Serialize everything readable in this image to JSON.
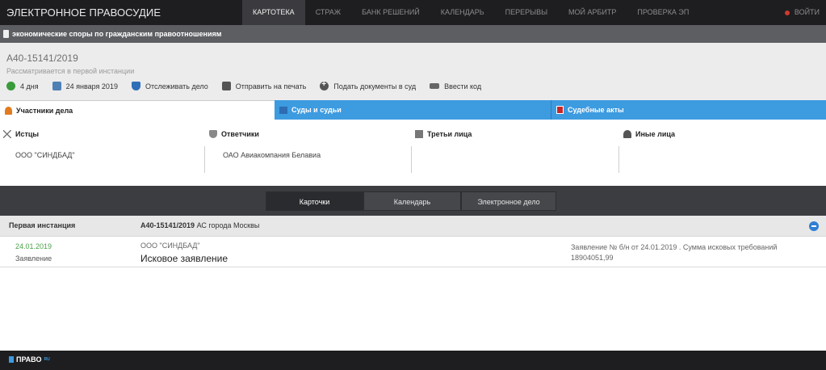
{
  "header": {
    "brand": "ЭЛЕКТРОННОЕ ПРАВОСУДИЕ",
    "nav": [
      "КАРТОТЕКА",
      "СТРАЖ",
      "БАНК РЕШЕНИЙ",
      "КАЛЕНДАРЬ",
      "ПЕРЕРЫВЫ",
      "МОЙ АРБИТР",
      "ПРОВЕРКА ЭП"
    ],
    "active_nav": "КАРТОТЕКА",
    "logout": "ВОЙТИ"
  },
  "category": "экономические споры по гражданским правоотношениям",
  "case": {
    "number": "А40-15141/2019",
    "status": "Рассматривается в первой инстанции",
    "actions": [
      "4 дня",
      "24 января 2019",
      "Отслеживать дело",
      "Отправить на печать",
      "Подать документы в суд",
      "Ввести код"
    ]
  },
  "tabs": [
    "Участники дела",
    "Суды и судьи",
    "Судебные акты"
  ],
  "parties": {
    "plaintiffs": {
      "title": "Истцы",
      "value": "ООО \"СИНДБАД\""
    },
    "defendants": {
      "title": "Ответчики",
      "value": "ОАО Авиакомпания Белавиа"
    },
    "third": {
      "title": "Третьи лица",
      "value": ""
    },
    "other": {
      "title": "Иные лица",
      "value": ""
    }
  },
  "view_tabs": [
    "Карточки",
    "Календарь",
    "Электронное дело"
  ],
  "instance": {
    "title": "Первая инстанция",
    "case_number": "А40-15141/2019",
    "court": " АС города Москвы"
  },
  "entry": {
    "date": "24.01.2019",
    "type": "Заявление",
    "party": "ООО \"СИНДБАД\"",
    "document": "Исковое заявление",
    "description": "Заявление № б/н от 24.01.2019 . Сумма исковых требований 18904051,99"
  },
  "footer": {
    "logo": "ПРАВО",
    "logo_suffix": "RU"
  },
  "colors": {
    "topbar": "#1e1e21",
    "accent_blue": "#3d9be0",
    "date_green": "#4aa24a"
  }
}
